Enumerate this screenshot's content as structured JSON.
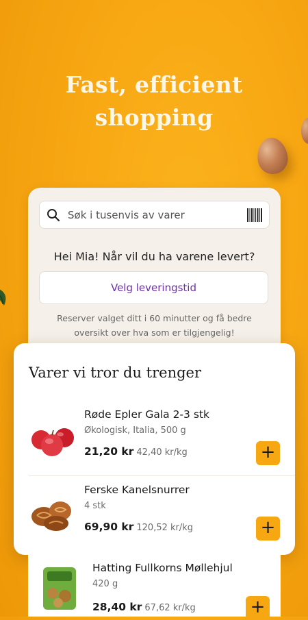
{
  "hero": {
    "line1": "Fast, efficient",
    "line2": "shopping"
  },
  "search": {
    "placeholder": "Søk i tusenvis av varer",
    "icon": "search-icon",
    "scan_icon": "barcode-icon"
  },
  "delivery": {
    "greeting": "Hei Mia! Når vil du ha varene levert?",
    "button_label": "Velg leveringstid",
    "note": "Reserver valget ditt i 60 minutter og få bedre oversikt over hva som er tilgjengelig!"
  },
  "recommend": {
    "title": "Varer vi tror du trenger",
    "items": [
      {
        "name": "Røde Epler Gala 2-3 stk",
        "desc": "Økologisk, Italia, 500 g",
        "price": "21,20 kr",
        "unit_price": "42,40 kr/kg",
        "image": "apples-image"
      },
      {
        "name": "Ferske Kanelsnurrer",
        "desc": "4 stk",
        "price": "69,90 kr",
        "unit_price": "120,52 kr/kg",
        "image": "cinnamon-rolls-image"
      },
      {
        "name": "Hatting Fullkorns Møllehjul",
        "desc": "420 g",
        "price": "28,40 kr",
        "unit_price": "67,62 kr/kg",
        "image": "bread-bag-image"
      }
    ]
  },
  "colors": {
    "accent": "#F7A712",
    "link": "#6B2FA8",
    "card_bg": "#F5F1EA"
  }
}
